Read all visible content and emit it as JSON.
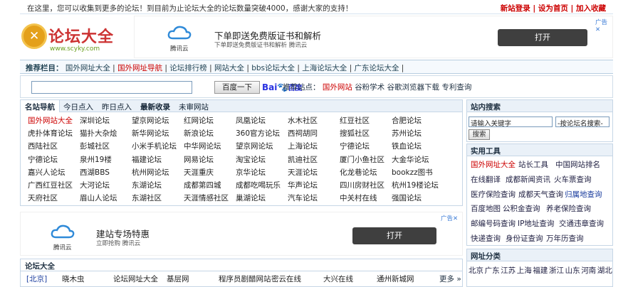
{
  "topbar": {
    "notice": "在这里，您可以收集到更多的论坛！到目前为止论坛大全的论坛数量突破4000，感谢大家的支持！",
    "links": "新站登录 | 设为首页 | 加入收藏"
  },
  "logo": {
    "name": "论坛大全",
    "url": "www.scyky.com"
  },
  "ad1": {
    "brand": "腾讯云",
    "title": "下单即送免费版证书和解析",
    "desc": "下单即送免费版证书和解析 腾讯云",
    "button": "打开",
    "mark": "广告✕"
  },
  "recbar": {
    "label": "推荐栏目：",
    "items": [
      "国外网址大全",
      "国外网址导航",
      "论坛排行榜",
      "网站大全",
      "bbs论坛大全",
      "上海论坛大全",
      "广东论坛大全"
    ]
  },
  "search": {
    "button": "百度一下",
    "baidu": "百度",
    "rec_label": "推荐站点：",
    "rec_items": [
      "国外网站",
      "谷粉学术",
      "谷歌浏览器下载",
      "专利查询"
    ]
  },
  "nav_panel": {
    "tabs": [
      "名站导航",
      "今日点入",
      "昨日点入",
      "最新收录",
      "未审网站"
    ],
    "rows": [
      [
        "国外网站大全",
        "深圳论坛",
        "望京网论坛",
        "红网论坛",
        "凤凰论坛",
        "水木社区",
        "红豆社区",
        "合肥论坛"
      ],
      [
        "虎扑体育论坛",
        "猫扑大杂烩",
        "新华网论坛",
        "新浪论坛",
        "360官方论坛",
        "西祠胡同",
        "搜狐社区",
        "苏州论坛"
      ],
      [
        "西陆社区",
        "彭城社区",
        "小米手机论坛",
        "中华网论坛",
        "望京网论坛",
        "上海论坛",
        "宁德论坛",
        "铁血论坛"
      ],
      [
        "宁德论坛",
        "泉州19楼",
        "福建论坛",
        "网易论坛",
        "淘宝论坛",
        "凯迪社区",
        "厦门小鱼社区",
        "大金华论坛"
      ],
      [
        "嘉兴人论坛",
        "西湖BBS",
        "杭州网论坛",
        "天涯重庆",
        "京华论坛",
        "天涯论坛",
        "化龙巷论坛",
        "bookzz图书"
      ],
      [
        "广西红豆社区",
        "大河论坛",
        "东湖论坛",
        "成都第四城",
        "成都吃喝玩乐",
        "华声论坛",
        "四川房财社区",
        "杭州19楼论坛"
      ],
      [
        "天府社区",
        "眉山人论坛",
        "东湖社区",
        "天涯情感社区",
        "巢湖论坛",
        "汽车论坛",
        "中关村在线",
        "强国论坛"
      ]
    ]
  },
  "ad2": {
    "brand": "腾讯云",
    "title": "建站专场特惠",
    "desc": "立即抢购 腾讯云",
    "button": "打开",
    "mark": "广告✕"
  },
  "forum_panel": {
    "title": "论坛大全",
    "row_label": "[北京]",
    "items": [
      "晓木虫",
      "论坛网址大全",
      "基层网",
      "程序员剧醋网站",
      "密云在线",
      "大兴在线",
      "通州新城网"
    ],
    "more": "更多 »"
  },
  "side_search": {
    "title": "站内搜索",
    "placeholder": "请输入关键字",
    "select": "-按论坛名搜索-",
    "button": "搜索"
  },
  "tools": {
    "title": "实用工具",
    "rows": [
      [
        "国外网址大全",
        "站长工具",
        "中国网站排名"
      ],
      [
        "在线翻译",
        "成都新闻资讯",
        "火车票查询"
      ],
      [
        "医疗保险查询",
        "成都天气查询",
        "归属地查询"
      ],
      [
        "百度地图",
        "公积金查询",
        "养老保险查询"
      ],
      [
        "邮编号码查询",
        "IP地址查询",
        "交通违章查询"
      ],
      [
        "快递查询",
        "身份证查询",
        "万年历查询"
      ]
    ]
  },
  "url_cat": {
    "title": "网址分类",
    "items": [
      "北京",
      "广东",
      "江苏",
      "上海",
      "福建",
      "浙江",
      "山东",
      "河南",
      "湖北"
    ]
  }
}
